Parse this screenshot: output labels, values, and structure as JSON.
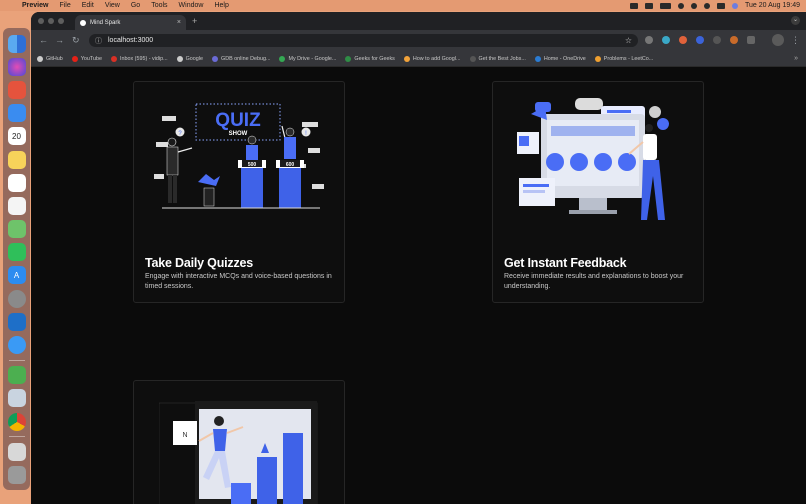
{
  "menubar": {
    "items": [
      "Preview",
      "File",
      "Edit",
      "View",
      "Go",
      "Tools",
      "Window",
      "Help"
    ],
    "datetime": "Tue 20 Aug  19:49"
  },
  "browser": {
    "tab_title": "Mind Spark",
    "url": "localhost:3000",
    "bookmarks": [
      {
        "label": "GitHub",
        "color": "#cccccc"
      },
      {
        "label": "YouTube",
        "color": "#e62117"
      },
      {
        "label": "Inbox (595) - vidip...",
        "color": "#d93025"
      },
      {
        "label": "Google",
        "color": "#cccccc"
      },
      {
        "label": "GDB online Debug...",
        "color": "#6b6bd6"
      },
      {
        "label": "My Drive - Google...",
        "color": "#34a853"
      },
      {
        "label": "Geeks for Geeks",
        "color": "#2f8d46"
      },
      {
        "label": "How to add Googl...",
        "color": "#f2a33a"
      },
      {
        "label": "Get the Best Jobs...",
        "color": "#555555"
      },
      {
        "label": "Home - OneDrive",
        "color": "#2b7cd3"
      },
      {
        "label": "Problems - LeetCo...",
        "color": "#f0a030"
      }
    ]
  },
  "features": [
    {
      "title": "Take Daily Quizzes",
      "description": "Engage with interactive MCQs and voice-based questions in timed sessions.",
      "illustration": "quiz-show-illustration",
      "sign_text": "QUIZ",
      "sign_sub": "SHOW",
      "podium_scores": [
        "500",
        "600"
      ]
    },
    {
      "title": "Get Instant Feedback",
      "description": "Receive immediate results and explanations to boost your understanding.",
      "illustration": "feedback-illustration"
    },
    {
      "title": "",
      "description": "",
      "illustration": "progress-chart-illustration"
    }
  ],
  "colors": {
    "accent": "#4a6df5",
    "page_bg": "#0b0b0b",
    "card_border": "#262626"
  }
}
